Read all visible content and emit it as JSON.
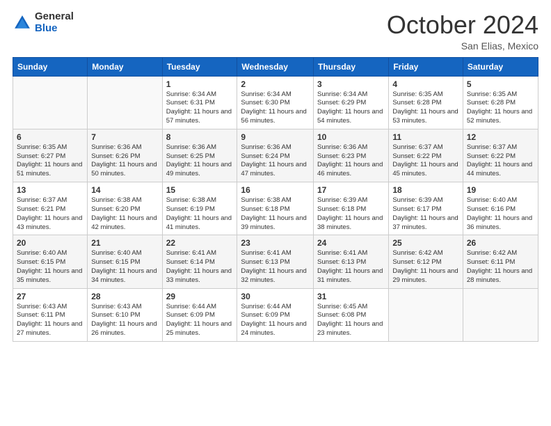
{
  "header": {
    "logo": {
      "general": "General",
      "blue": "Blue"
    },
    "month_title": "October 2024",
    "location": "San Elias, Mexico"
  },
  "days_of_week": [
    "Sunday",
    "Monday",
    "Tuesday",
    "Wednesday",
    "Thursday",
    "Friday",
    "Saturday"
  ],
  "weeks": [
    [
      {
        "day": "",
        "info": ""
      },
      {
        "day": "",
        "info": ""
      },
      {
        "day": "1",
        "info": "Sunrise: 6:34 AM\nSunset: 6:31 PM\nDaylight: 11 hours and 57 minutes."
      },
      {
        "day": "2",
        "info": "Sunrise: 6:34 AM\nSunset: 6:30 PM\nDaylight: 11 hours and 56 minutes."
      },
      {
        "day": "3",
        "info": "Sunrise: 6:34 AM\nSunset: 6:29 PM\nDaylight: 11 hours and 54 minutes."
      },
      {
        "day": "4",
        "info": "Sunrise: 6:35 AM\nSunset: 6:28 PM\nDaylight: 11 hours and 53 minutes."
      },
      {
        "day": "5",
        "info": "Sunrise: 6:35 AM\nSunset: 6:28 PM\nDaylight: 11 hours and 52 minutes."
      }
    ],
    [
      {
        "day": "6",
        "info": "Sunrise: 6:35 AM\nSunset: 6:27 PM\nDaylight: 11 hours and 51 minutes."
      },
      {
        "day": "7",
        "info": "Sunrise: 6:36 AM\nSunset: 6:26 PM\nDaylight: 11 hours and 50 minutes."
      },
      {
        "day": "8",
        "info": "Sunrise: 6:36 AM\nSunset: 6:25 PM\nDaylight: 11 hours and 49 minutes."
      },
      {
        "day": "9",
        "info": "Sunrise: 6:36 AM\nSunset: 6:24 PM\nDaylight: 11 hours and 47 minutes."
      },
      {
        "day": "10",
        "info": "Sunrise: 6:36 AM\nSunset: 6:23 PM\nDaylight: 11 hours and 46 minutes."
      },
      {
        "day": "11",
        "info": "Sunrise: 6:37 AM\nSunset: 6:22 PM\nDaylight: 11 hours and 45 minutes."
      },
      {
        "day": "12",
        "info": "Sunrise: 6:37 AM\nSunset: 6:22 PM\nDaylight: 11 hours and 44 minutes."
      }
    ],
    [
      {
        "day": "13",
        "info": "Sunrise: 6:37 AM\nSunset: 6:21 PM\nDaylight: 11 hours and 43 minutes."
      },
      {
        "day": "14",
        "info": "Sunrise: 6:38 AM\nSunset: 6:20 PM\nDaylight: 11 hours and 42 minutes."
      },
      {
        "day": "15",
        "info": "Sunrise: 6:38 AM\nSunset: 6:19 PM\nDaylight: 11 hours and 41 minutes."
      },
      {
        "day": "16",
        "info": "Sunrise: 6:38 AM\nSunset: 6:18 PM\nDaylight: 11 hours and 39 minutes."
      },
      {
        "day": "17",
        "info": "Sunrise: 6:39 AM\nSunset: 6:18 PM\nDaylight: 11 hours and 38 minutes."
      },
      {
        "day": "18",
        "info": "Sunrise: 6:39 AM\nSunset: 6:17 PM\nDaylight: 11 hours and 37 minutes."
      },
      {
        "day": "19",
        "info": "Sunrise: 6:40 AM\nSunset: 6:16 PM\nDaylight: 11 hours and 36 minutes."
      }
    ],
    [
      {
        "day": "20",
        "info": "Sunrise: 6:40 AM\nSunset: 6:15 PM\nDaylight: 11 hours and 35 minutes."
      },
      {
        "day": "21",
        "info": "Sunrise: 6:40 AM\nSunset: 6:15 PM\nDaylight: 11 hours and 34 minutes."
      },
      {
        "day": "22",
        "info": "Sunrise: 6:41 AM\nSunset: 6:14 PM\nDaylight: 11 hours and 33 minutes."
      },
      {
        "day": "23",
        "info": "Sunrise: 6:41 AM\nSunset: 6:13 PM\nDaylight: 11 hours and 32 minutes."
      },
      {
        "day": "24",
        "info": "Sunrise: 6:41 AM\nSunset: 6:13 PM\nDaylight: 11 hours and 31 minutes."
      },
      {
        "day": "25",
        "info": "Sunrise: 6:42 AM\nSunset: 6:12 PM\nDaylight: 11 hours and 29 minutes."
      },
      {
        "day": "26",
        "info": "Sunrise: 6:42 AM\nSunset: 6:11 PM\nDaylight: 11 hours and 28 minutes."
      }
    ],
    [
      {
        "day": "27",
        "info": "Sunrise: 6:43 AM\nSunset: 6:11 PM\nDaylight: 11 hours and 27 minutes."
      },
      {
        "day": "28",
        "info": "Sunrise: 6:43 AM\nSunset: 6:10 PM\nDaylight: 11 hours and 26 minutes."
      },
      {
        "day": "29",
        "info": "Sunrise: 6:44 AM\nSunset: 6:09 PM\nDaylight: 11 hours and 25 minutes."
      },
      {
        "day": "30",
        "info": "Sunrise: 6:44 AM\nSunset: 6:09 PM\nDaylight: 11 hours and 24 minutes."
      },
      {
        "day": "31",
        "info": "Sunrise: 6:45 AM\nSunset: 6:08 PM\nDaylight: 11 hours and 23 minutes."
      },
      {
        "day": "",
        "info": ""
      },
      {
        "day": "",
        "info": ""
      }
    ]
  ]
}
